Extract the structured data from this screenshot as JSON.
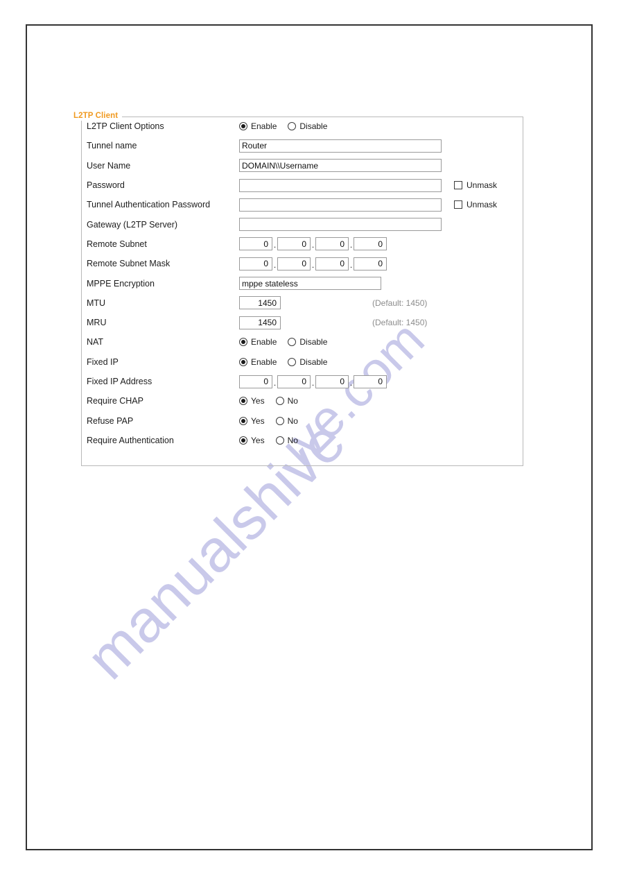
{
  "panel": {
    "legend": "L2TP Client"
  },
  "watermark": {
    "line1": "manualshive",
    "line2": "ive.com"
  },
  "options": {
    "enable": "Enable",
    "disable": "Disable",
    "yes": "Yes",
    "no": "No",
    "unmask": "Unmask"
  },
  "rows": {
    "client_options": {
      "label": "L2TP Client Options",
      "selected": "Enable"
    },
    "tunnel_name": {
      "label": "Tunnel name",
      "value": "Router",
      "placeholder": ""
    },
    "user_name": {
      "label": "User Name",
      "value": "DOMAIN\\\\Username",
      "placeholder": ""
    },
    "password": {
      "label": "Password",
      "value": "",
      "placeholder": "",
      "unmask_label": "Unmask",
      "unmask_checked": false
    },
    "tunnel_auth_password": {
      "label": "Tunnel Authentication Password",
      "value": "",
      "placeholder": "",
      "unmask_label": "Unmask",
      "unmask_checked": false
    },
    "gateway": {
      "label": "Gateway (L2TP Server)",
      "value": "",
      "placeholder": ""
    },
    "remote_subnet": {
      "label": "Remote Subnet",
      "octets": [
        "0",
        "0",
        "0",
        "0"
      ]
    },
    "remote_subnet_mask": {
      "label": "Remote Subnet Mask",
      "octets": [
        "0",
        "0",
        "0",
        "0"
      ]
    },
    "mppe_encryption": {
      "label": "MPPE Encryption",
      "value": "mppe stateless",
      "placeholder": ""
    },
    "mtu": {
      "label": "MTU",
      "value": "1450",
      "hint": "(Default: 1450)"
    },
    "mru": {
      "label": "MRU",
      "value": "1450",
      "hint": "(Default: 1450)"
    },
    "nat": {
      "label": "NAT",
      "selected": "Enable"
    },
    "fixed_ip": {
      "label": "Fixed IP",
      "selected": "Enable"
    },
    "fixed_ip_address": {
      "label": "Fixed IP Address",
      "octets": [
        "0",
        "0",
        "0",
        "0"
      ]
    },
    "require_chap": {
      "label": "Require CHAP",
      "selected": "Yes"
    },
    "refuse_pap": {
      "label": "Refuse PAP",
      "selected": "Yes"
    },
    "require_authentication": {
      "label": "Require Authentication",
      "selected": "Yes"
    }
  },
  "colors": {
    "legend_orange": "#f09a21",
    "panel_border": "#b9b9b9",
    "page_border": "#333333",
    "watermark": "#c9c9ea",
    "hint_gray": "#8c8c8c"
  }
}
